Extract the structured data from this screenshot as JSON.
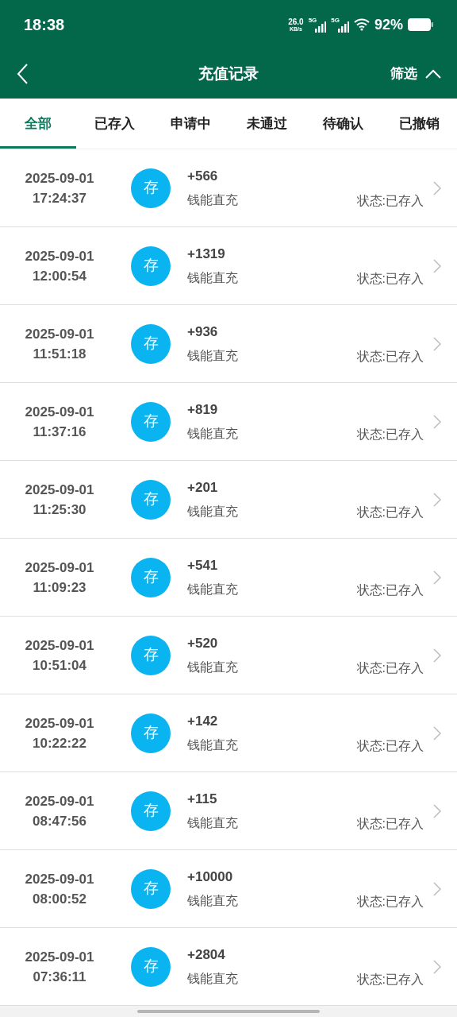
{
  "status_bar": {
    "time": "18:38",
    "net_speed": "26.0",
    "net_unit": "KB/s",
    "sim_1": "5G",
    "sim_2": "5G",
    "battery": "92%"
  },
  "header": {
    "title": "充值记录",
    "filter": "筛选"
  },
  "tabs": [
    {
      "label": "全部",
      "selected": true
    },
    {
      "label": "已存入",
      "selected": false
    },
    {
      "label": "申请中",
      "selected": false
    },
    {
      "label": "未通过",
      "selected": false
    },
    {
      "label": "待确认",
      "selected": false
    },
    {
      "label": "已撤销",
      "selected": false
    }
  ],
  "records": [
    {
      "date": "2025-09-01",
      "time": "17:24:37",
      "badge": "存",
      "amount": "+566",
      "method": "钱能直充",
      "status": "状态:已存入"
    },
    {
      "date": "2025-09-01",
      "time": "12:00:54",
      "badge": "存",
      "amount": "+1319",
      "method": "钱能直充",
      "status": "状态:已存入"
    },
    {
      "date": "2025-09-01",
      "time": "11:51:18",
      "badge": "存",
      "amount": "+936",
      "method": "钱能直充",
      "status": "状态:已存入"
    },
    {
      "date": "2025-09-01",
      "time": "11:37:16",
      "badge": "存",
      "amount": "+819",
      "method": "钱能直充",
      "status": "状态:已存入"
    },
    {
      "date": "2025-09-01",
      "time": "11:25:30",
      "badge": "存",
      "amount": "+201",
      "method": "钱能直充",
      "status": "状态:已存入"
    },
    {
      "date": "2025-09-01",
      "time": "11:09:23",
      "badge": "存",
      "amount": "+541",
      "method": "钱能直充",
      "status": "状态:已存入"
    },
    {
      "date": "2025-09-01",
      "time": "10:51:04",
      "badge": "存",
      "amount": "+520",
      "method": "钱能直充",
      "status": "状态:已存入"
    },
    {
      "date": "2025-09-01",
      "time": "10:22:22",
      "badge": "存",
      "amount": "+142",
      "method": "钱能直充",
      "status": "状态:已存入"
    },
    {
      "date": "2025-09-01",
      "time": "08:47:56",
      "badge": "存",
      "amount": "+115",
      "method": "钱能直充",
      "status": "状态:已存入"
    },
    {
      "date": "2025-09-01",
      "time": "08:00:52",
      "badge": "存",
      "amount": "+10000",
      "method": "钱能直充",
      "status": "状态:已存入"
    },
    {
      "date": "2025-09-01",
      "time": "07:36:11",
      "badge": "存",
      "amount": "+2804",
      "method": "钱能直充",
      "status": "状态:已存入"
    }
  ]
}
